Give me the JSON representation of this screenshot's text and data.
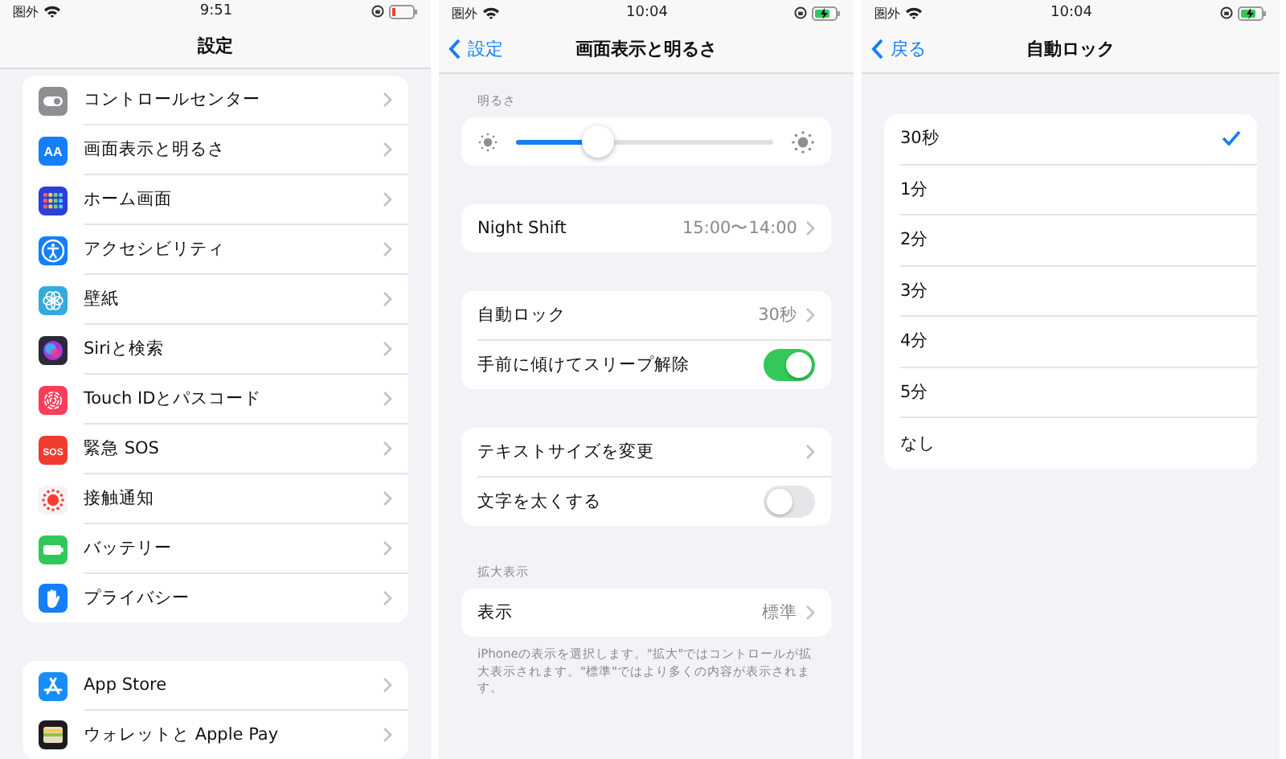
{
  "screens": [
    {
      "kind": "settings",
      "status": {
        "carrier": "圏外",
        "time": "9:51",
        "charging": false
      },
      "nav": {
        "title": "設定"
      },
      "groups": [
        {
          "items": [
            {
              "kind": "control",
              "label": "コントロールセンター"
            },
            {
              "kind": "display",
              "icon_text": "AA",
              "label": "画面表示と明るさ"
            },
            {
              "kind": "home",
              "label": "ホーム画面"
            },
            {
              "kind": "accessibility",
              "label": "アクセシビリティ"
            },
            {
              "kind": "wallpaper",
              "label": "壁紙"
            },
            {
              "kind": "siri",
              "label": "Siriと検索"
            },
            {
              "kind": "fingerprint",
              "label": "Touch IDとパスコード"
            },
            {
              "kind": "sos",
              "icon_text": "SOS",
              "label": "緊急 SOS"
            },
            {
              "kind": "exposure",
              "label": "接触通知"
            },
            {
              "kind": "battery",
              "label": "バッテリー"
            },
            {
              "kind": "privacy",
              "label": "プライバシー"
            }
          ]
        },
        {
          "items": [
            {
              "kind": "appstore",
              "label": "App Store"
            },
            {
              "kind": "wallet",
              "label": "ウォレットと Apple Pay"
            }
          ]
        }
      ]
    },
    {
      "kind": "display",
      "status": {
        "carrier": "圏外",
        "time": "10:04",
        "charging": true
      },
      "nav": {
        "back": "設定",
        "title": "画面表示と明るさ"
      },
      "groups": [
        {
          "header": "明るさ",
          "items": [
            {
              "kind": "slider",
              "level": 0.32
            }
          ]
        },
        {
          "items": [
            {
              "kind": "value",
              "label": "Night Shift",
              "value": "15:00〜14:00"
            }
          ]
        },
        {
          "items": [
            {
              "kind": "value",
              "label": "自動ロック",
              "value": "30秒"
            },
            {
              "kind": "toggle",
              "label": "手前に傾けてスリープ解除",
              "on": true
            }
          ]
        },
        {
          "items": [
            {
              "kind": "link",
              "label": "テキストサイズを変更"
            },
            {
              "kind": "toggle",
              "label": "文字を太くする",
              "on": false
            }
          ]
        },
        {
          "header": "拡大表示",
          "items": [
            {
              "kind": "value",
              "label": "表示",
              "value": "標準"
            }
          ],
          "footer": "iPhoneの表示を選択します。\"拡大\"ではコントロールが拡大表示されます。\"標準\"ではより多くの内容が表示されます。"
        }
      ]
    },
    {
      "kind": "autolock",
      "status": {
        "carrier": "圏外",
        "time": "10:04",
        "charging": true
      },
      "nav": {
        "back": "戻る",
        "title": "自動ロック"
      },
      "groups": [
        {
          "items": [
            {
              "kind": "option",
              "label": "30秒",
              "selected": true
            },
            {
              "kind": "option",
              "label": "1分",
              "selected": false
            },
            {
              "kind": "option",
              "label": "2分",
              "selected": false
            },
            {
              "kind": "option",
              "label": "3分",
              "selected": false
            },
            {
              "kind": "option",
              "label": "4分",
              "selected": false
            },
            {
              "kind": "option",
              "label": "5分",
              "selected": false
            },
            {
              "kind": "option",
              "label": "なし",
              "selected": false
            }
          ]
        }
      ]
    }
  ]
}
